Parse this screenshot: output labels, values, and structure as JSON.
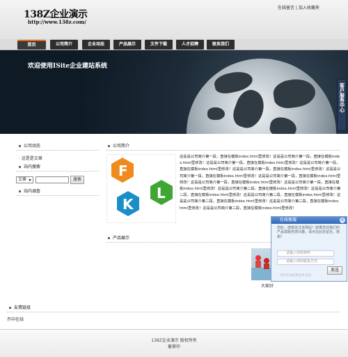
{
  "header": {
    "logo": "138Z企业演示",
    "url": "http://www.138z.com/",
    "links": [
      "在线留言",
      "加入收藏夹"
    ]
  },
  "nav": [
    "首页",
    "公司简介",
    "企业动态",
    "产品展示",
    "文件下载",
    "人才招聘",
    "联系我们"
  ],
  "banner": {
    "slogan": "欢迎使用ISite企业建站系统",
    "service_label": "客户服务中心"
  },
  "left": {
    "news_title": "公司动态",
    "news_items": [
      "这是是文章"
    ],
    "search_title": "站内搜索",
    "search_type": "文章",
    "search_button": "搜索",
    "survey_title": "站内调查"
  },
  "about": {
    "title": "公司简介",
    "logo_letters": [
      "F",
      "L",
      "K"
    ],
    "text": "这是是公司简介第一段，直接在模板index.html里修改！这是是公司简介第一段，直接在模板index.html里修改！这是是公司简介第一段，直接在模板index.html里修改！这是是公司简介第一段，直接在模板index.html里修改！这是是公司简介第一段，直接在模板index.html里修改！这是是公司简介第一段，直接在模板index.html里修改！这是是公司简介第一段，直接在模板index.html里修改！这是是公司简介第一段，直接在模板index.html里修改！这是是公司简介第一段，直接在模板index.html里修改！这是是公司简介第二段，直接在模板index.html里修改！这是是公司简介第二段，直接在模板index.html里修改！这是是公司简介第二段，直接在模板index.html里修改！这是是公司简介第二段，直接在模板index.html里修改！这是是公司简介第二段，直接在模板index.html里修改！这是是公司简介第二段，直接在模板index.html里修改！"
  },
  "products": {
    "title": "产品展示",
    "item_name": "大家好"
  },
  "chat": {
    "title": "在线客服",
    "message": "您好，感谢关注本网站！如果您对我们的产品或服务感兴趣，请点击此处留言，谢谢！",
    "name_placeholder": "请输入你的称呼",
    "contact_placeholder": "请输入你的联系方式",
    "send": "发送",
    "footer": "洽中在线提供技术支持"
  },
  "links": {
    "title": "友情链接",
    "item": "齐中在线"
  },
  "footer": {
    "line1": "138Z企业演示 版权所有",
    "line2": "备案中"
  }
}
